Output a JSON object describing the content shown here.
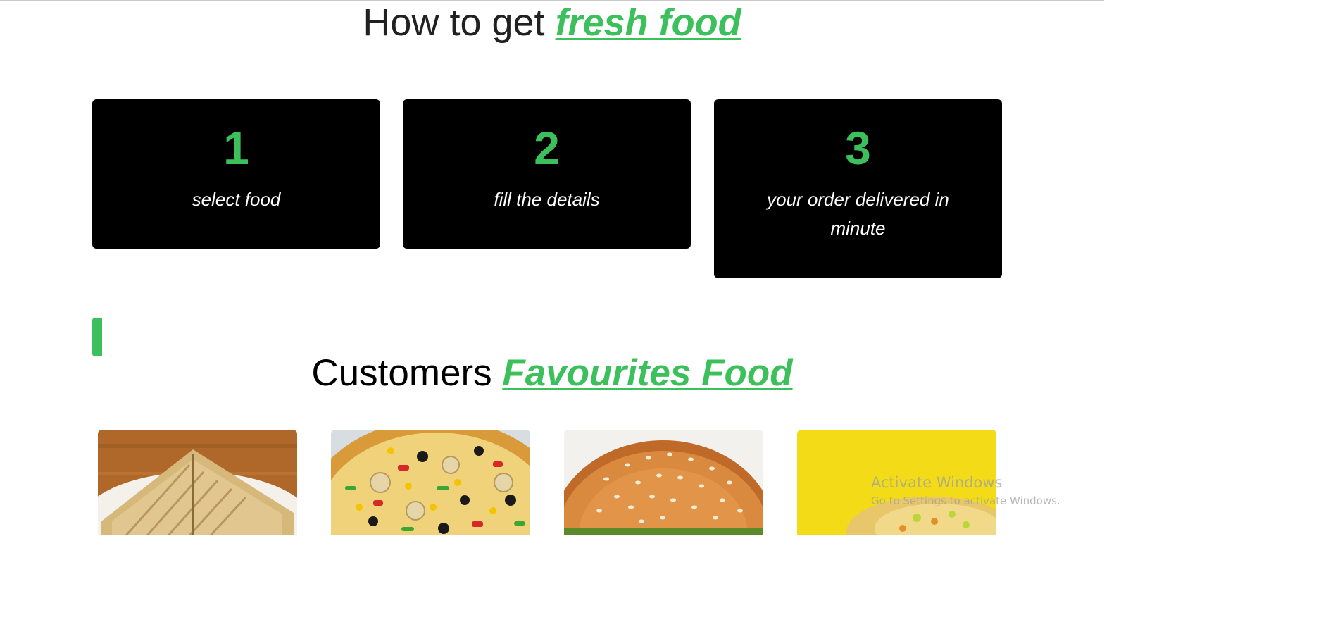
{
  "colors": {
    "accent": "#3cc05b",
    "card_bg": "#000000"
  },
  "how_section": {
    "title_prefix": "How to get",
    "title_accent": "fresh food",
    "steps": [
      {
        "number": "1",
        "text": "select food"
      },
      {
        "number": "2",
        "text": "fill the details"
      },
      {
        "number": "3",
        "text": "your order delivered in minute"
      }
    ]
  },
  "favourites_section": {
    "title_prefix": "Customers",
    "title_accent": "Favourites Food",
    "items": [
      {
        "image_icon": "sandwich-image"
      },
      {
        "image_icon": "pizza-image"
      },
      {
        "image_icon": "burger-image"
      },
      {
        "image_icon": "wrap-image"
      }
    ]
  },
  "watermark": {
    "line1": "Activate Windows",
    "line2": "Go to Settings to activate Windows."
  }
}
